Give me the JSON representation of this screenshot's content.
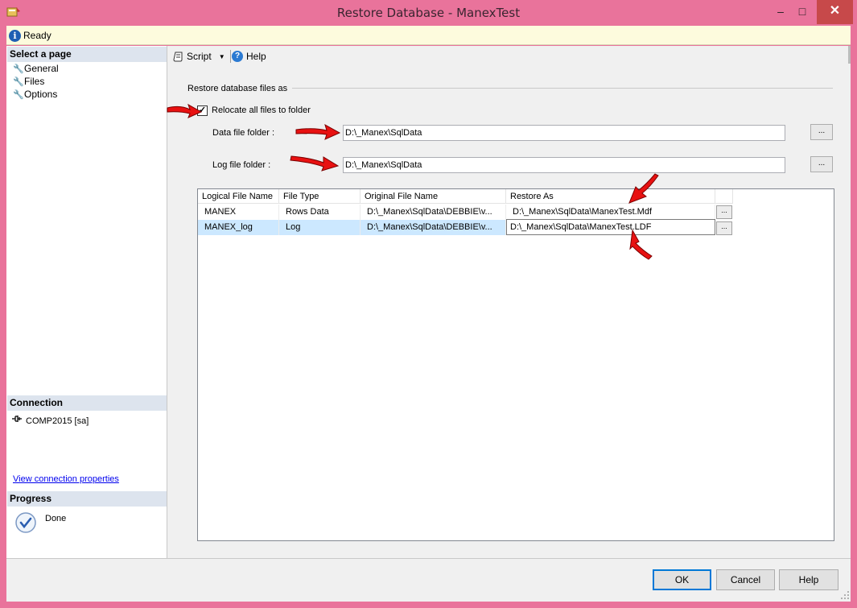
{
  "window": {
    "title": "Restore Database - ManexTest",
    "minimize_glyph": "–",
    "maximize_glyph": "□",
    "close_glyph": "✕"
  },
  "status": {
    "text": "Ready",
    "icon": "info-icon"
  },
  "sidebar": {
    "select_page_header": "Select a page",
    "pages": [
      {
        "label": "General",
        "icon": "wrench-icon"
      },
      {
        "label": "Files",
        "icon": "wrench-icon"
      },
      {
        "label": "Options",
        "icon": "wrench-icon"
      }
    ],
    "connection_header": "Connection",
    "connection_text": "COMP2015 [sa]",
    "view_connection_link": "View connection properties",
    "progress_header": "Progress",
    "progress_status": "Done"
  },
  "toolbar": {
    "script_label": "Script",
    "help_label": "Help"
  },
  "restore_files": {
    "group_label": "Restore database files as",
    "relocate_label": "Relocate all files to folder",
    "relocate_checked": true,
    "data_folder_label": "Data file folder :",
    "data_folder_value": "D:\\_Manex\\SqlData",
    "log_folder_label": "Log file folder :",
    "log_folder_value": "D:\\_Manex\\SqlData",
    "browse_label": "..."
  },
  "grid": {
    "columns": [
      "Logical File Name",
      "File Type",
      "Original File Name",
      "Restore As"
    ],
    "rows": [
      {
        "logical": "MANEX",
        "type": "Rows Data",
        "original": "D:\\_Manex\\SqlData\\DEBBIE\\v...",
        "restore_as": "D:\\_Manex\\SqlData\\ManexTest.Mdf"
      },
      {
        "logical": "MANEX_log",
        "type": "Log",
        "original": "D:\\_Manex\\SqlData\\DEBBIE\\v...",
        "restore_as": "D:\\_Manex\\SqlData\\ManexTest.LDF"
      }
    ],
    "row_browse_label": "..."
  },
  "buttons": {
    "ok": "OK",
    "cancel": "Cancel",
    "help": "Help"
  },
  "colors": {
    "window_frame": "#e9739b",
    "status_background": "#fdfbdd",
    "selected_row": "#cce8ff",
    "section_header": "#dde4ee",
    "annotation_arrow": "#e81111"
  }
}
